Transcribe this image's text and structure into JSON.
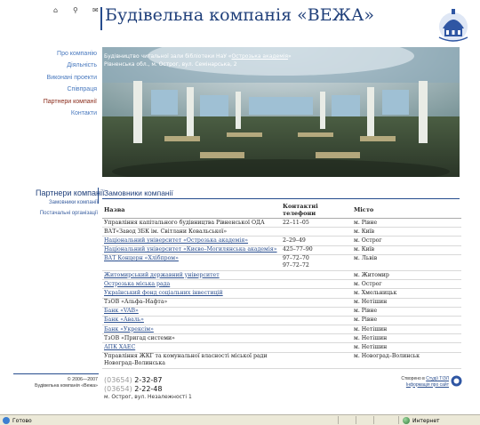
{
  "header": {
    "title": "Будівельна компанія «ВЕЖА»",
    "icons": [
      "home-icon",
      "search-icon",
      "mail-icon"
    ]
  },
  "nav": [
    {
      "label": "Про компанію",
      "active": false
    },
    {
      "label": "Діяльність",
      "active": false
    },
    {
      "label": "Виконані проекти",
      "active": false
    },
    {
      "label": "Співпраця",
      "active": false
    },
    {
      "label": "Партнери компанії",
      "active": true
    },
    {
      "label": "Контакти",
      "active": false
    }
  ],
  "banner": {
    "line1_prefix": "Будівництво читальної зали бібліотеки НаУ «",
    "line1_link": "Острозька академія",
    "line1_suffix": "»",
    "line2": "Рівненська обл., м. Острог, вул. Семінарська, 2"
  },
  "partners": {
    "title": "Партнери компанії",
    "links": [
      "Замовники компанії",
      "Постачальні організації"
    ]
  },
  "main": {
    "title": "Замовники компанії",
    "columns": [
      "Назва",
      "Контактні телефони",
      "Місто"
    ],
    "rows": [
      {
        "name": "Управління капітального будівництва Рівненської ОДА",
        "link": false,
        "phone": "22–11–05",
        "city": "м. Рівне"
      },
      {
        "name": "ВАТ«Завод ЗБК ім. Світлани Ковальської»",
        "link": false,
        "phone": "",
        "city": "м. Київ"
      },
      {
        "name": "Національний університет «Острозька академія»",
        "link": true,
        "phone": "2–29–49",
        "city": "м. Острог"
      },
      {
        "name": "Національний університет «Києво–Могилянська академія»",
        "link": true,
        "phone": "425–77–90",
        "city": "м. Київ"
      },
      {
        "name": "ВАТ Концерн «Хлібпром»",
        "link": true,
        "phone": "97–72–70\n97–72–72",
        "city": "м. Львів"
      },
      {
        "name": "Житомирський державний університет",
        "link": true,
        "phone": "",
        "city": "м. Житомир"
      },
      {
        "name": "Острозька міська рада",
        "link": true,
        "phone": "",
        "city": "м. Острог"
      },
      {
        "name": "Український фонд соціальних інвестицій",
        "link": true,
        "phone": "",
        "city": "м. Хмельницьк"
      },
      {
        "name": "ТзОВ «Альфа–Нафта»",
        "link": false,
        "phone": "",
        "city": "м. Нетішин"
      },
      {
        "name": "Банк «VAB»",
        "link": true,
        "phone": "",
        "city": "м. Рівне"
      },
      {
        "name": "Банк «Аваль»",
        "link": true,
        "phone": "",
        "city": "м. Рівне"
      },
      {
        "name": "Банк «Укрексім»",
        "link": true,
        "phone": "",
        "city": "м. Нетішин"
      },
      {
        "name": "ТзОВ «Пригад системи»",
        "link": false,
        "phone": "",
        "city": "м. Нетішин"
      },
      {
        "name": "АПК ХАЕС",
        "link": true,
        "phone": "",
        "city": "м. Нетішин"
      },
      {
        "name": "Управління ЖКГ та комунальної власності міської ради Новоград–Волинська",
        "link": false,
        "phone": "",
        "city": "м. Новоград–Волинськ"
      }
    ]
  },
  "footer": {
    "copyright": "© 2006—2007",
    "company": "Будівельна компанія «Вежа»",
    "phones": [
      {
        "code": "(03654)",
        "number": "2-32-87"
      },
      {
        "code": "(03654)",
        "number": "2-22-48"
      }
    ],
    "address": "м. Острог, вул. Незалежності 1",
    "created_prefix": "Створено в ",
    "created_link": "Студії ТІЗЛ",
    "info_link": "Інформація про сайт"
  },
  "statusbar": {
    "left": "Готово",
    "right": "Интернет"
  },
  "colors": {
    "accent": "#264c8e",
    "nav_link": "#4a7abf",
    "nav_active": "#8a2b1a"
  }
}
